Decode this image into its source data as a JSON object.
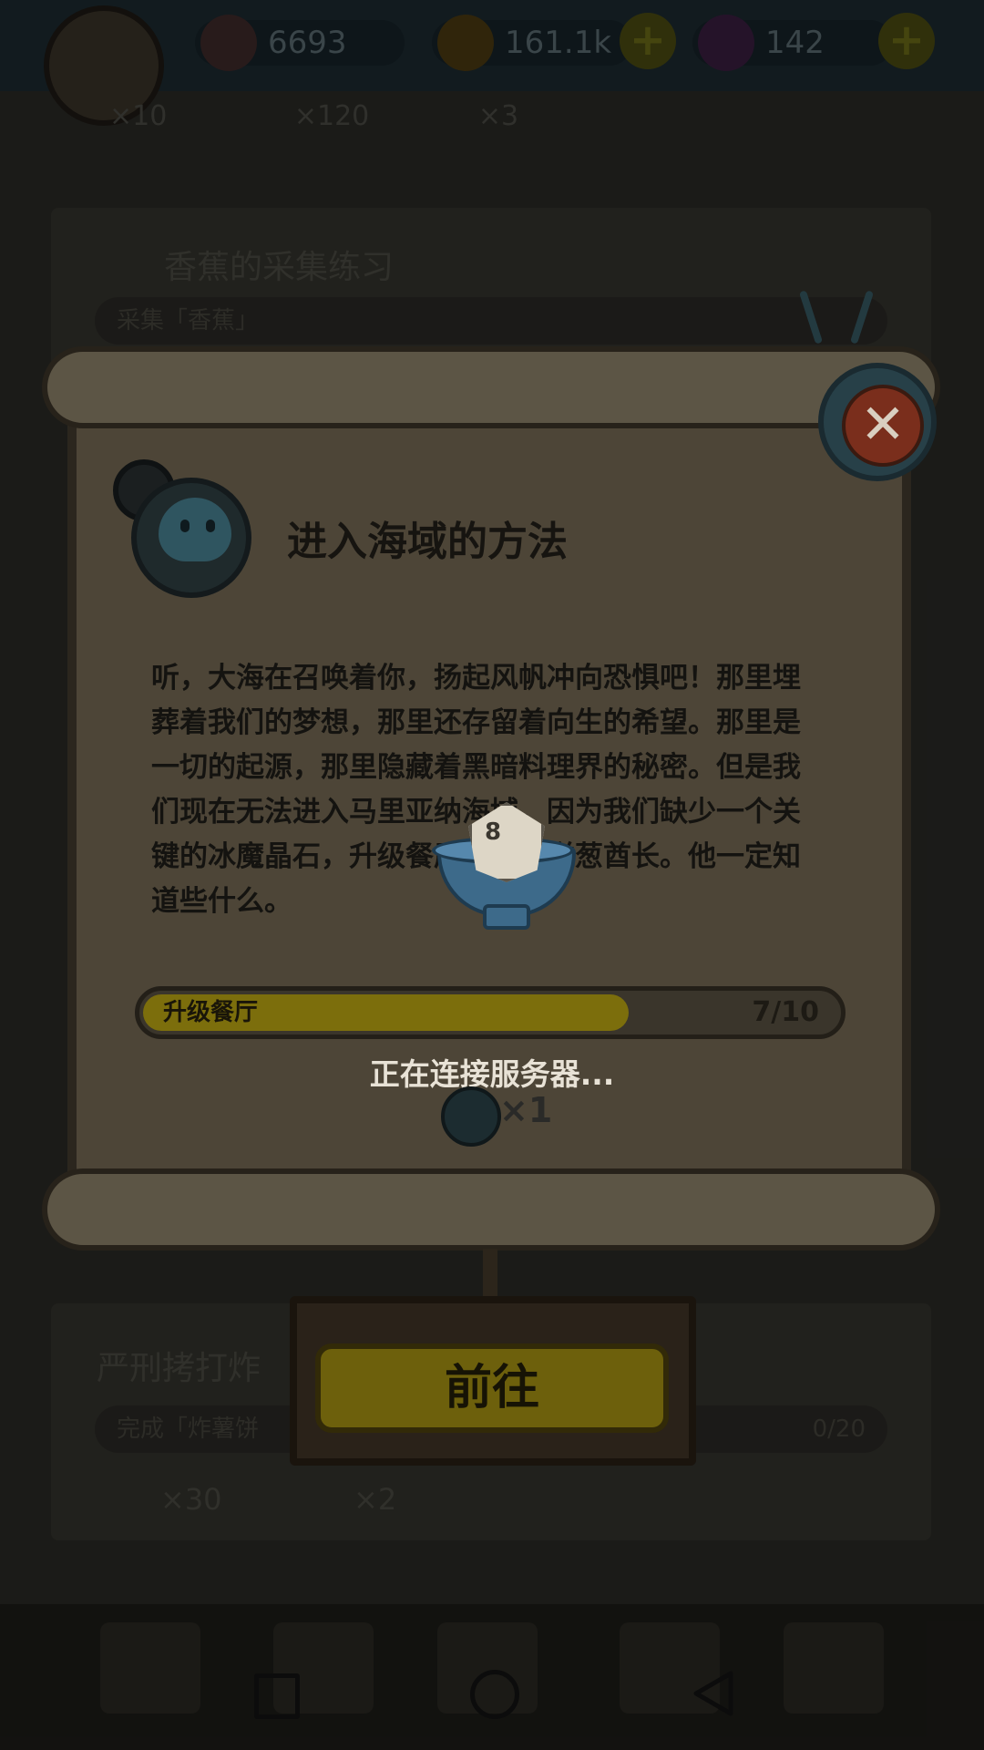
{
  "hud": {
    "gem_count": "6693",
    "gold_count": "161.1k",
    "potion_count": "142",
    "reward_strip": [
      "×10",
      "×120",
      "×3"
    ]
  },
  "background_tasks": [
    {
      "title": "香蕉的采集练习",
      "goal": "采集「香蕉」"
    },
    {
      "title": "严刑拷打炸",
      "goal": "完成「炸薯饼",
      "progress": "0/20",
      "rewards": [
        "×30",
        "×2"
      ]
    }
  ],
  "modal": {
    "title": "进入海域的方法",
    "description": "听，大海在召唤着你，扬起风帆冲向恐惧吧！那里埋葬着我们的梦想，那里还存留着向生的希望。那里是一切的起源，那里隐藏着黑暗料理界的秘密。但是我们现在无法进入马里亚纳海域，因为我们缺少一个关键的冰魔晶石，升级餐厅并找到洋葱酋长。他一定知道些什么。",
    "objective_label": "升级餐厅",
    "objective_progress": "7/10",
    "progress_fraction": 0.7,
    "reward_amount": "×1",
    "go_button": "前往",
    "close_icon": "close-icon"
  },
  "loading": {
    "status_text": "正在连接服务器...",
    "die_number": "8"
  },
  "colors": {
    "scroll_parchment": "#4d4537",
    "progress_fill": "#7c6e0c",
    "go_button": "#6d600c",
    "close_button": "#7a2e1c"
  }
}
